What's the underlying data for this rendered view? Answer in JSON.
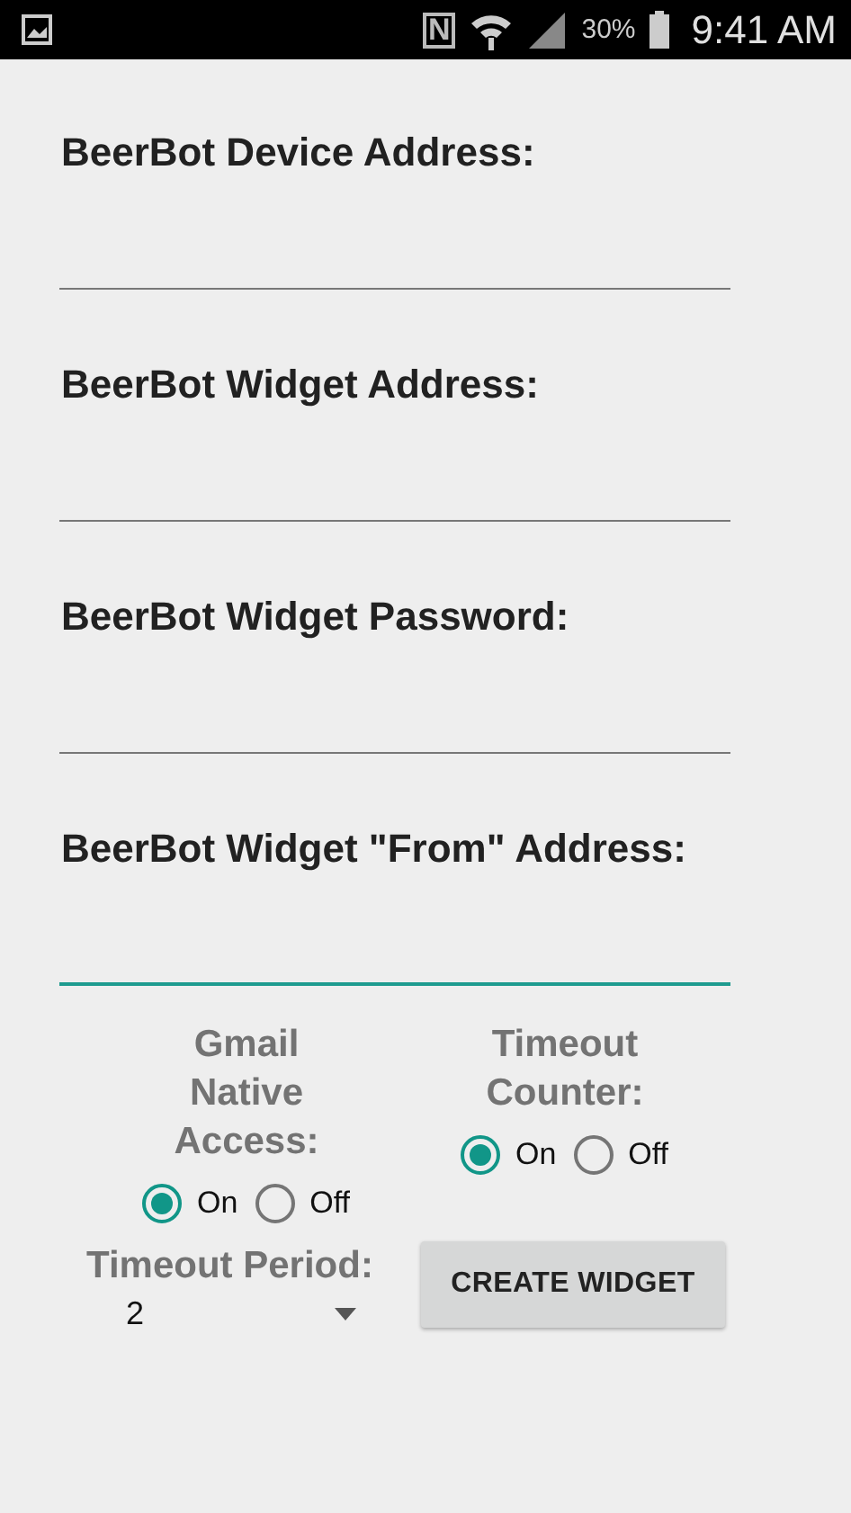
{
  "status_bar": {
    "nfc": "N",
    "battery_text": "30%",
    "time": "9:41 AM"
  },
  "fields": [
    {
      "label": "BeerBot Device Address:",
      "focused": false
    },
    {
      "label": "BeerBot Widget Address:",
      "focused": false
    },
    {
      "label": "BeerBot Widget Password:",
      "focused": false
    },
    {
      "label": "BeerBot Widget \"From\" Address:",
      "focused": true
    }
  ],
  "option_groups": [
    {
      "label": "Gmail Native Access:",
      "choices": [
        {
          "label": "On",
          "selected": true
        },
        {
          "label": "Off",
          "selected": false
        }
      ]
    },
    {
      "label": "Timeout Counter:",
      "choices": [
        {
          "label": "On",
          "selected": true
        },
        {
          "label": "Off",
          "selected": false
        }
      ]
    }
  ],
  "timeout_period": {
    "label": "Timeout Period:",
    "value": "2"
  },
  "button": {
    "label": "CREATE WIDGET"
  }
}
